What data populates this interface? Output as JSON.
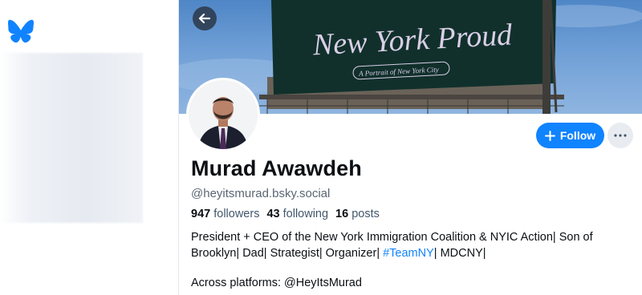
{
  "colors": {
    "accent": "#1083fe",
    "text": "#0b0f14",
    "muted": "#5b6673"
  },
  "banner": {
    "billboard_title": "New York Proud",
    "billboard_subtitle": "A Portrait of New York City"
  },
  "profile": {
    "display_name": "Murad Awawdeh",
    "handle": "@heyitsmurad.bsky.social",
    "followers_count": "947",
    "followers_label": "followers",
    "following_count": "43",
    "following_label": "following",
    "posts_count": "16",
    "posts_label": "posts",
    "bio_part1": "President + CEO of the New York Immigration Coalition & NYIC Action| Son of Brooklyn| Dad| Strategist| Organizer| ",
    "bio_hashtag": "#TeamNY",
    "bio_part2": "| MDCNY|",
    "bio_line3": "Across platforms: @HeyItsMurad"
  },
  "actions": {
    "follow_label": "Follow"
  },
  "icons": {
    "logo": "butterfly-logo-icon",
    "back": "arrow-left-icon",
    "follow": "plus-icon",
    "more": "ellipsis-icon"
  }
}
